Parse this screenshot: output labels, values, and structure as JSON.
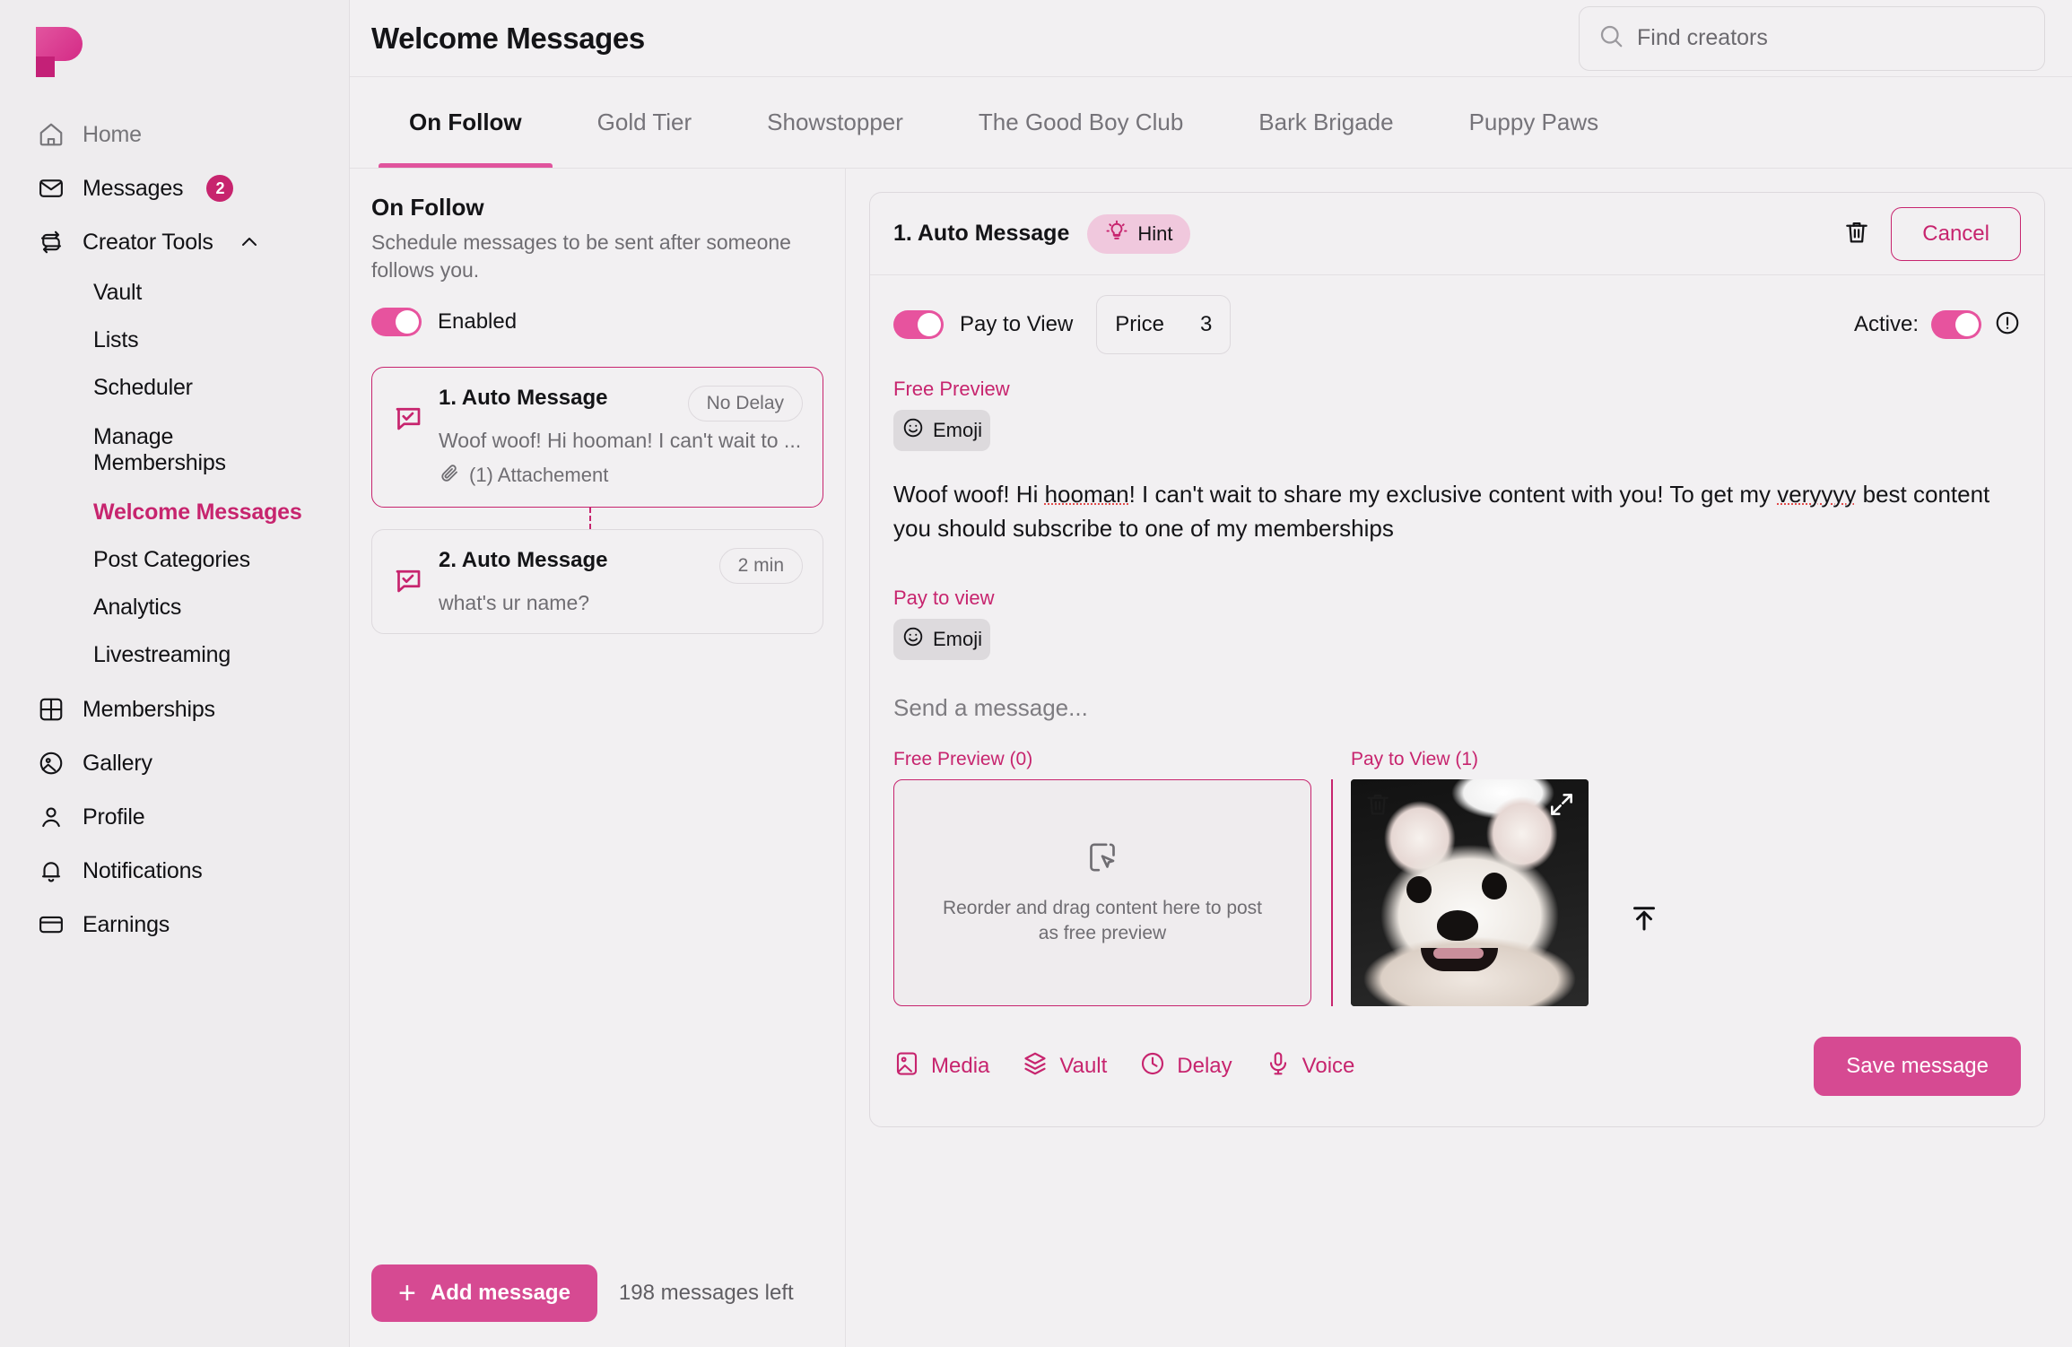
{
  "brand": {
    "accent": "#c7246e",
    "accent_button": "#d64a92",
    "toggle_on": "#e7539e",
    "hint_bg": "#f0c8dd"
  },
  "sidebar": {
    "logo_name": "patreon-style-p-logo",
    "items": [
      {
        "label": "Home",
        "icon": "home-icon",
        "muted": true
      },
      {
        "label": "Messages",
        "icon": "envelope-icon",
        "badge": "2"
      },
      {
        "label": "Creator Tools",
        "icon": "repeat-box-icon",
        "expanded": true
      }
    ],
    "creator_tools_sub": [
      {
        "label": "Vault"
      },
      {
        "label": "Lists"
      },
      {
        "label": "Scheduler"
      },
      {
        "label": "Manage Memberships"
      },
      {
        "label": "Welcome Messages",
        "active": true
      },
      {
        "label": "Post Categories"
      },
      {
        "label": "Analytics"
      },
      {
        "label": "Livestreaming"
      }
    ],
    "items_bottom": [
      {
        "label": "Memberships",
        "icon": "grid-icon"
      },
      {
        "label": "Gallery",
        "icon": "image-circle-icon"
      },
      {
        "label": "Profile",
        "icon": "user-icon"
      },
      {
        "label": "Notifications",
        "icon": "bell-icon"
      },
      {
        "label": "Earnings",
        "icon": "card-icon"
      }
    ]
  },
  "header": {
    "title": "Welcome Messages",
    "search": {
      "placeholder": "Find creators",
      "value": ""
    }
  },
  "tabs": [
    {
      "label": "On Follow",
      "active": true
    },
    {
      "label": "Gold Tier",
      "active": false
    },
    {
      "label": "Showstopper",
      "active": false
    },
    {
      "label": "The Good Boy Club",
      "active": false
    },
    {
      "label": "Bark Brigade",
      "active": false
    },
    {
      "label": "Puppy Paws",
      "active": false
    }
  ],
  "left_panel": {
    "title": "On Follow",
    "description": "Schedule messages to be sent after someone follows you.",
    "enabled_label": "Enabled",
    "enabled": true,
    "messages": [
      {
        "title": "1. Auto Message",
        "delay": "No Delay",
        "preview": "Woof woof! Hi hooman! I can't wait to ...",
        "attachment": "(1) Attachement",
        "selected": true
      },
      {
        "title": "2. Auto Message",
        "delay": "2 min",
        "preview": "what's ur name?",
        "attachment": "",
        "selected": false
      }
    ],
    "add_button": "Add message",
    "messages_left": "198 messages left"
  },
  "editor": {
    "title": "1. Auto Message",
    "hint_label": "Hint",
    "delete_icon": "trash-icon",
    "cancel_label": "Cancel",
    "pay_to_view_label": "Pay to View",
    "pay_to_view_on": true,
    "price_label": "Price",
    "price_value": "3",
    "active_label": "Active:",
    "active_on": true,
    "free_preview_label": "Free Preview",
    "emoji_label": "Emoji",
    "message_text": "Woof woof! Hi hooman! I can't wait to share my exclusive content with you! To get my veryyyy best content you should subscribe to one of my memberships",
    "message_text_parts": {
      "a": "Woof woof! Hi ",
      "misspelled1": "hooman",
      "b": "! I can't wait to share my exclusive content with you! To get my ",
      "misspelled2": "veryyyy",
      "c": " best content you should subscribe to one of my memberships"
    },
    "pay_to_view_section_label": "Pay to view",
    "emoji_label_2": "Emoji",
    "send_placeholder": "Send a message...",
    "free_preview_count_label": "Free Preview (0)",
    "dropzone_text": "Reorder and drag content here to post as free preview",
    "pay_to_view_count_label": "Pay to View (1)",
    "thumbnail_alt": "white pomeranian dog photo",
    "tools": [
      {
        "label": "Media",
        "icon": "image-icon"
      },
      {
        "label": "Vault",
        "icon": "layers-icon"
      },
      {
        "label": "Delay",
        "icon": "clock-icon"
      },
      {
        "label": "Voice",
        "icon": "microphone-icon"
      }
    ],
    "save_label": "Save message"
  }
}
